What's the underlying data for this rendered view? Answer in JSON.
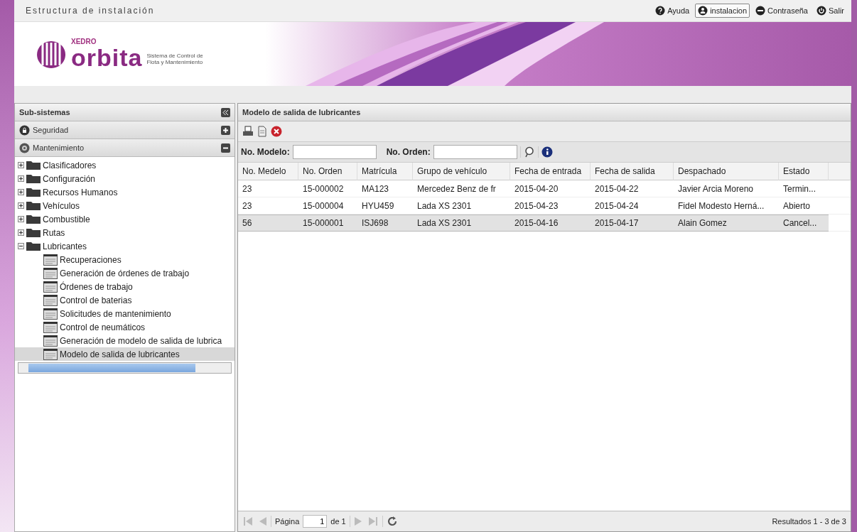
{
  "header": {
    "title": "Estructura de instalación",
    "links": [
      {
        "label": "Ayuda",
        "kind": "help",
        "selected": false
      },
      {
        "label": "instalacion",
        "kind": "user",
        "selected": true
      },
      {
        "label": "Contraseña",
        "kind": "password",
        "selected": false
      },
      {
        "label": "Salir",
        "kind": "logout",
        "selected": false
      }
    ]
  },
  "banner": {
    "brand": "XEDRO",
    "product": "orbita",
    "tagline_1": "Sistema de Control de",
    "tagline_2": "Flota y Mantenimiento"
  },
  "sidebar": {
    "title": "Sub-sistemas",
    "sections": [
      {
        "label": "Seguridad",
        "kind": "lock",
        "expanded": false
      },
      {
        "label": "Mantenimiento",
        "kind": "gear",
        "expanded": true
      }
    ],
    "tree": [
      {
        "label": "Clasificadores",
        "expanded": false,
        "selected": false
      },
      {
        "label": "Configuración",
        "expanded": false,
        "selected": false
      },
      {
        "label": "Recursos Humanos",
        "expanded": false,
        "selected": false
      },
      {
        "label": "Vehículos",
        "expanded": false,
        "selected": false
      },
      {
        "label": "Combustible",
        "expanded": false,
        "selected": false
      },
      {
        "label": "Rutas",
        "expanded": false,
        "selected": false
      },
      {
        "label": "Lubricantes",
        "expanded": true,
        "selected": false,
        "children": [
          {
            "label": "Recuperaciones",
            "selected": false
          },
          {
            "label": "Generación de órdenes de trabajo",
            "selected": false
          },
          {
            "label": "Órdenes de trabajo",
            "selected": false
          },
          {
            "label": "Control de baterias",
            "selected": false
          },
          {
            "label": "Solicitudes de mantenimiento",
            "selected": false
          },
          {
            "label": "Control de neumáticos",
            "selected": false
          },
          {
            "label": "Generación de modelo de salida de lubrica",
            "selected": false
          },
          {
            "label": "Modelo de salida de lubricantes",
            "selected": true
          }
        ]
      }
    ]
  },
  "panel": {
    "title": "Modelo de salida de lubricantes",
    "filters": [
      {
        "label": "No. Modelo:"
      },
      {
        "label": "No. Orden:"
      }
    ],
    "table": {
      "columns": [
        "No. Medelo",
        "No. Orden",
        "Matrícula",
        "Grupo de vehículo",
        "Fecha de entrada",
        "Fecha de salida",
        "Despachado",
        "Estado"
      ],
      "rows": [
        {
          "cells": [
            "23",
            "15-000002",
            "MA123",
            "Mercedez Benz de fr",
            "2015-04-20",
            "2015-04-22",
            "Javier Arcia Moreno",
            "Termin..."
          ],
          "selected": false
        },
        {
          "cells": [
            "23",
            "15-000004",
            "HYU459",
            "Lada XS 2301",
            "2015-04-23",
            "2015-04-24",
            "Fidel Modesto Herná...",
            "Abierto"
          ],
          "selected": false
        },
        {
          "cells": [
            "56",
            "15-000001",
            "ISJ698",
            "Lada XS 2301",
            "2015-04-16",
            "2015-04-17",
            "Alain Gomez",
            "Cancel..."
          ],
          "selected": true
        }
      ]
    },
    "pager": {
      "page_label": "Página",
      "page": "1",
      "of_label": "de 1",
      "results": "Resultados 1 - 3 de 3"
    }
  }
}
